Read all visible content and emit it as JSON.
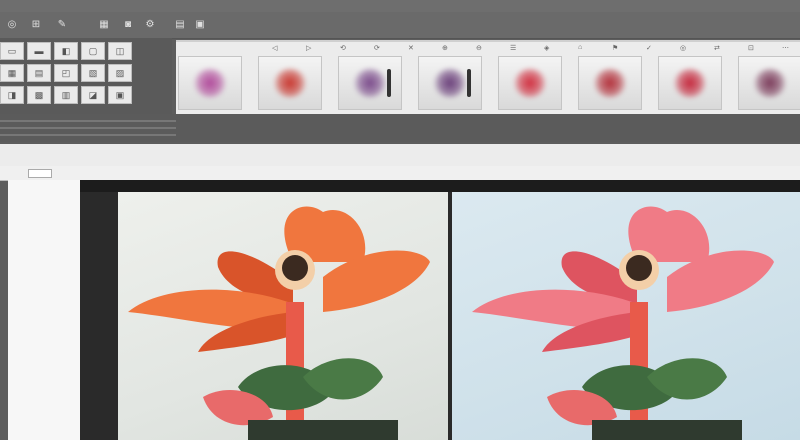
{
  "titlebar": {
    "text": ""
  },
  "toolbar": {
    "buttons": [
      {
        "icon": "move-icon",
        "glyph": "◎"
      },
      {
        "icon": "crop-icon",
        "glyph": "⊞"
      },
      {
        "icon": "brush-icon",
        "glyph": "✎"
      },
      {
        "icon": "layers-icon",
        "glyph": "▦"
      },
      {
        "icon": "camera-icon",
        "glyph": "◙"
      },
      {
        "icon": "settings-icon",
        "glyph": "⚙"
      },
      {
        "icon": "grid-icon",
        "glyph": "▤"
      },
      {
        "icon": "image-icon",
        "glyph": "▣"
      }
    ]
  },
  "tool_panel": {
    "cells": [
      "▭",
      "▬",
      "◧",
      "▢",
      "◫",
      "▦",
      "▤",
      "◰",
      "▧",
      "▨",
      "◨",
      "▩",
      "▥",
      "◪",
      "▣"
    ]
  },
  "filmstrip": {
    "icons": [
      "◁",
      "▷",
      "⟲",
      "⟳",
      "✕",
      "⊕",
      "⊖",
      "☰",
      "◈",
      "⌂",
      "⚑",
      "✓",
      "◎",
      "⇄",
      "⊡",
      "⋯"
    ],
    "thumbs": [
      {
        "color": "#b04a9a",
        "bar": false
      },
      {
        "color": "#c8372f",
        "bar": false
      },
      {
        "color": "#7a4a8a",
        "bar": true
      },
      {
        "color": "#6a3f7a",
        "bar": true
      },
      {
        "color": "#d02f3f",
        "bar": false
      },
      {
        "color": "#b2303a",
        "bar": false
      },
      {
        "color": "#c4283c",
        "bar": false
      },
      {
        "color": "#7b3b5a",
        "bar": false
      }
    ]
  },
  "doc_toolbar": {
    "items": [
      "",
      "",
      "",
      "",
      "",
      ""
    ]
  },
  "canvas": {
    "header_left": "",
    "header_right": "",
    "left_image": {
      "petal": "#f0763e",
      "petal_dark": "#d9542a",
      "bg": "#e8ebe6"
    },
    "right_image": {
      "petal": "#f07b86",
      "petal_dark": "#de5460",
      "bg": "#d3e5ee"
    },
    "stem": "#e85a4a",
    "leaf": "#3f6b3f",
    "pot": "#e86a6a"
  }
}
